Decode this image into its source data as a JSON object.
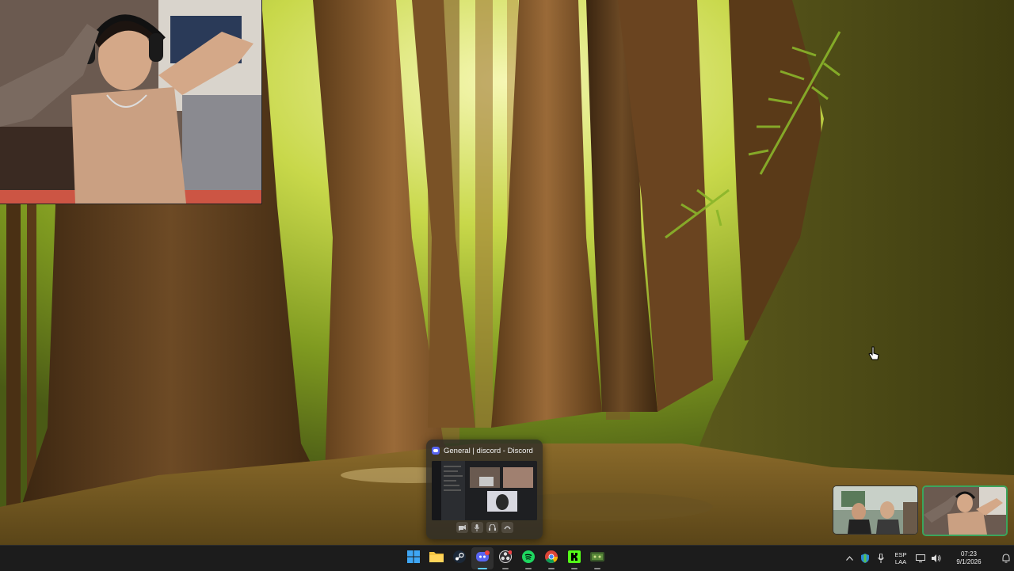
{
  "desktop": {
    "wallpaper": "redwood-forest",
    "accent": "#60cdff"
  },
  "webcam_overlay": {
    "type": "streamer-camera"
  },
  "taskbar_preview": {
    "title": "General | discord - Discord",
    "app_icon": "discord-icon",
    "controls": [
      "camera-icon",
      "microphone-icon",
      "headphones-icon",
      "hang-up-icon"
    ]
  },
  "call_tiles": [
    {
      "participants": 2,
      "speaking": false
    },
    {
      "participants": 1,
      "speaking": true,
      "speaking_color": "#3ba55d"
    }
  ],
  "taskbar": {
    "apps": [
      {
        "name": "start",
        "icon": "windows-start-icon",
        "active": false,
        "open": false
      },
      {
        "name": "file-explorer",
        "icon": "folder-icon",
        "active": false,
        "open": false
      },
      {
        "name": "steam",
        "icon": "steam-icon",
        "active": false,
        "open": false
      },
      {
        "name": "discord",
        "icon": "discord-icon",
        "active": true,
        "open": true,
        "badge": "9+"
      },
      {
        "name": "obs",
        "icon": "obs-icon",
        "active": false,
        "open": true,
        "badge": "1"
      },
      {
        "name": "spotify",
        "icon": "spotify-icon",
        "active": false,
        "open": true
      },
      {
        "name": "chrome",
        "icon": "chrome-icon",
        "active": false,
        "open": true
      },
      {
        "name": "kick",
        "icon": "kick-icon",
        "active": false,
        "open": true
      },
      {
        "name": "game",
        "icon": "controller-icon",
        "active": false,
        "open": true
      }
    ],
    "tray": {
      "language": "ESP",
      "layout": "LAA",
      "time": "07:23",
      "date": "9/1/2026"
    }
  }
}
